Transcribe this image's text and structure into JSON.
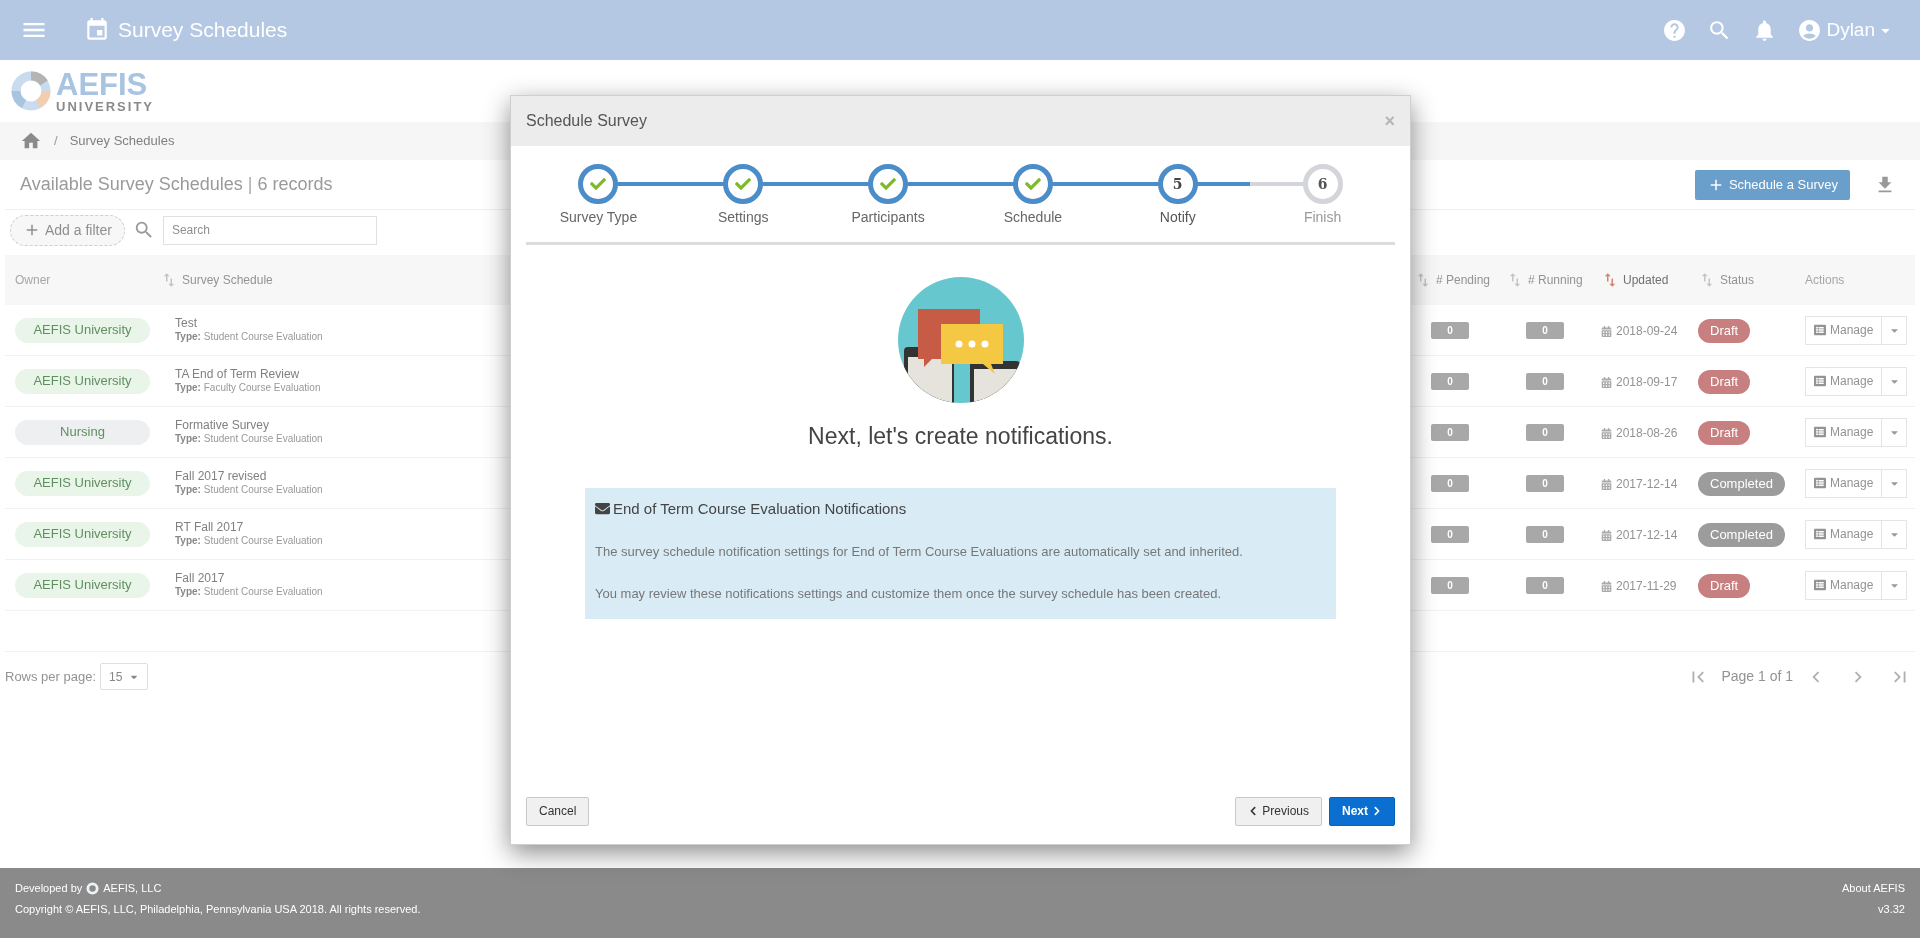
{
  "header": {
    "title": "Survey Schedules",
    "user": "Dylan"
  },
  "logo": {
    "name": "AEFIS",
    "subtitle": "UNIVERSITY"
  },
  "breadcrumb": {
    "separator": "/",
    "items": [
      "Survey Schedules"
    ]
  },
  "page": {
    "title": "Available Survey Schedules",
    "separator": "|",
    "count": "6 records",
    "primary_button": "Schedule a Survey"
  },
  "filter": {
    "add_filter": "Add a filter",
    "search_placeholder": "Search"
  },
  "table": {
    "columns": [
      {
        "label": "Owner",
        "sortable": false,
        "sorted": false
      },
      {
        "label": "Survey Schedule",
        "sortable": true,
        "sorted": false
      },
      {
        "label": "# Pending",
        "sortable": true,
        "sorted": false
      },
      {
        "label": "# Running",
        "sortable": true,
        "sorted": false
      },
      {
        "label": "Updated",
        "sortable": true,
        "sorted": true
      },
      {
        "label": "Status",
        "sortable": true,
        "sorted": false
      },
      {
        "label": "Actions",
        "sortable": false,
        "sorted": false
      }
    ],
    "rows": [
      {
        "owner": {
          "label": "AEFIS University",
          "color": "#eaf5ea"
        },
        "name": "Test",
        "type_label": "Type:",
        "type": "Student Course Evaluation",
        "pending": "0",
        "running": "0",
        "updated": "2018-09-24",
        "status": {
          "label": "Draft",
          "kind": "draft"
        },
        "action": "Manage"
      },
      {
        "owner": {
          "label": "AEFIS University",
          "color": "#eaf5ea"
        },
        "name": "TA End of Term Review",
        "type_label": "Type:",
        "type": "Faculty Course Evaluation",
        "pending": "0",
        "running": "0",
        "updated": "2018-09-17",
        "status": {
          "label": "Draft",
          "kind": "draft"
        },
        "action": "Manage"
      },
      {
        "owner": {
          "label": "Nursing",
          "color": "#eeeff1"
        },
        "name": "Formative Survey",
        "type_label": "Type:",
        "type": "Student Course Evaluation",
        "pending": "0",
        "running": "0",
        "updated": "2018-08-26",
        "status": {
          "label": "Draft",
          "kind": "draft"
        },
        "action": "Manage"
      },
      {
        "owner": {
          "label": "AEFIS University",
          "color": "#eaf5ea"
        },
        "name": "Fall 2017 revised",
        "type_label": "Type:",
        "type": "Student Course Evaluation",
        "pending": "0",
        "running": "0",
        "updated": "2017-12-14",
        "status": {
          "label": "Completed",
          "kind": "completed"
        },
        "action": "Manage"
      },
      {
        "owner": {
          "label": "AEFIS University",
          "color": "#eaf5ea"
        },
        "name": "RT Fall 2017",
        "type_label": "Type:",
        "type": "Student Course Evaluation",
        "pending": "0",
        "running": "0",
        "updated": "2017-12-14",
        "status": {
          "label": "Completed",
          "kind": "completed"
        },
        "action": "Manage"
      },
      {
        "owner": {
          "label": "AEFIS University",
          "color": "#eaf5ea"
        },
        "name": "Fall 2017",
        "type_label": "Type:",
        "type": "Student Course Evaluation",
        "pending": "0",
        "running": "0",
        "updated": "2017-11-29",
        "status": {
          "label": "Draft",
          "kind": "draft"
        },
        "action": "Manage"
      }
    ]
  },
  "pagination": {
    "rows_per_page_label": "Rows per page:",
    "rows_per_page": "15",
    "page": "Page 1 of 1"
  },
  "modal": {
    "title": "Schedule Survey",
    "close": "×",
    "steps": [
      {
        "label": "Survey Type",
        "completed": true,
        "selected": false
      },
      {
        "label": "Settings",
        "completed": true,
        "selected": false
      },
      {
        "label": "Participants",
        "completed": true,
        "selected": false
      },
      {
        "label": "Schedule",
        "completed": true,
        "selected": false
      },
      {
        "label": "Notify",
        "number": "5",
        "completed": false,
        "selected": true
      },
      {
        "label": "Finish",
        "number": "6",
        "completed": false,
        "selected": false
      }
    ],
    "heading": "Next, let's create notifications.",
    "info": {
      "title": "End of Term Course Evaluation Notifications",
      "paragraphs": [
        "The survey schedule notification settings for End of Term Course Evaluations are automatically set and inherited.",
        "You may review these notifications settings and customize them once the survey schedule has been created."
      ]
    },
    "buttons": {
      "cancel": "Cancel",
      "previous": "Previous",
      "next": "Next"
    }
  },
  "footer": {
    "developed_by": "Developed by",
    "company": "AEFIS, LLC",
    "copyright": "Copyright © AEFIS, LLC, Philadelphia, Pennsylvania USA 2018. All rights reserved.",
    "about": "About AEFIS",
    "version": "v3.32"
  }
}
